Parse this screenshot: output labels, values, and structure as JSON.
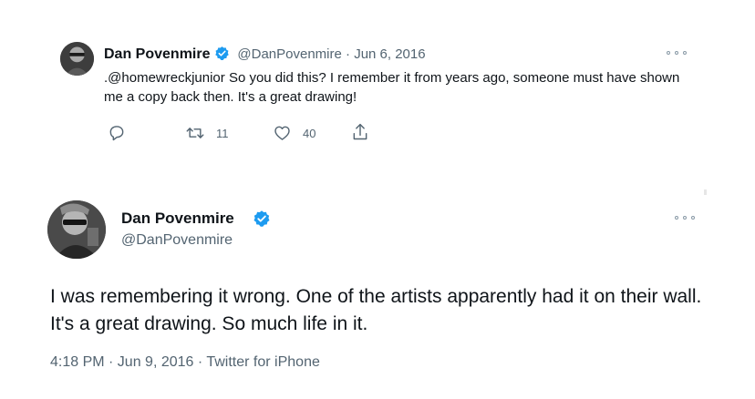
{
  "colors": {
    "text_primary": "#0f1419",
    "text_secondary": "#536471",
    "verified_blue": "#1d9bf0",
    "background": "#ffffff"
  },
  "reply_tweet": {
    "author_name": "Dan Povenmire",
    "handle": "@DanPovenmire",
    "separator": "·",
    "date": "Jun 6, 2016",
    "text": ".@homewreckjunior So you did this?  I remember it from years ago, someone must have shown me a copy back then. It's a great drawing!",
    "actions": {
      "reply_icon": "reply-icon",
      "retweet_icon": "retweet-icon",
      "retweet_count": "11",
      "like_icon": "heart-icon",
      "like_count": "40",
      "share_icon": "share-icon"
    }
  },
  "main_tweet": {
    "author_name": "Dan Povenmire",
    "handle": "@DanPovenmire",
    "text": "I was remembering it wrong. One of the artists apparently had it on their wall. It's a great drawing. So much life in it.",
    "meta": "4:18 PM · Jun 9, 2016 · Twitter for iPhone"
  }
}
